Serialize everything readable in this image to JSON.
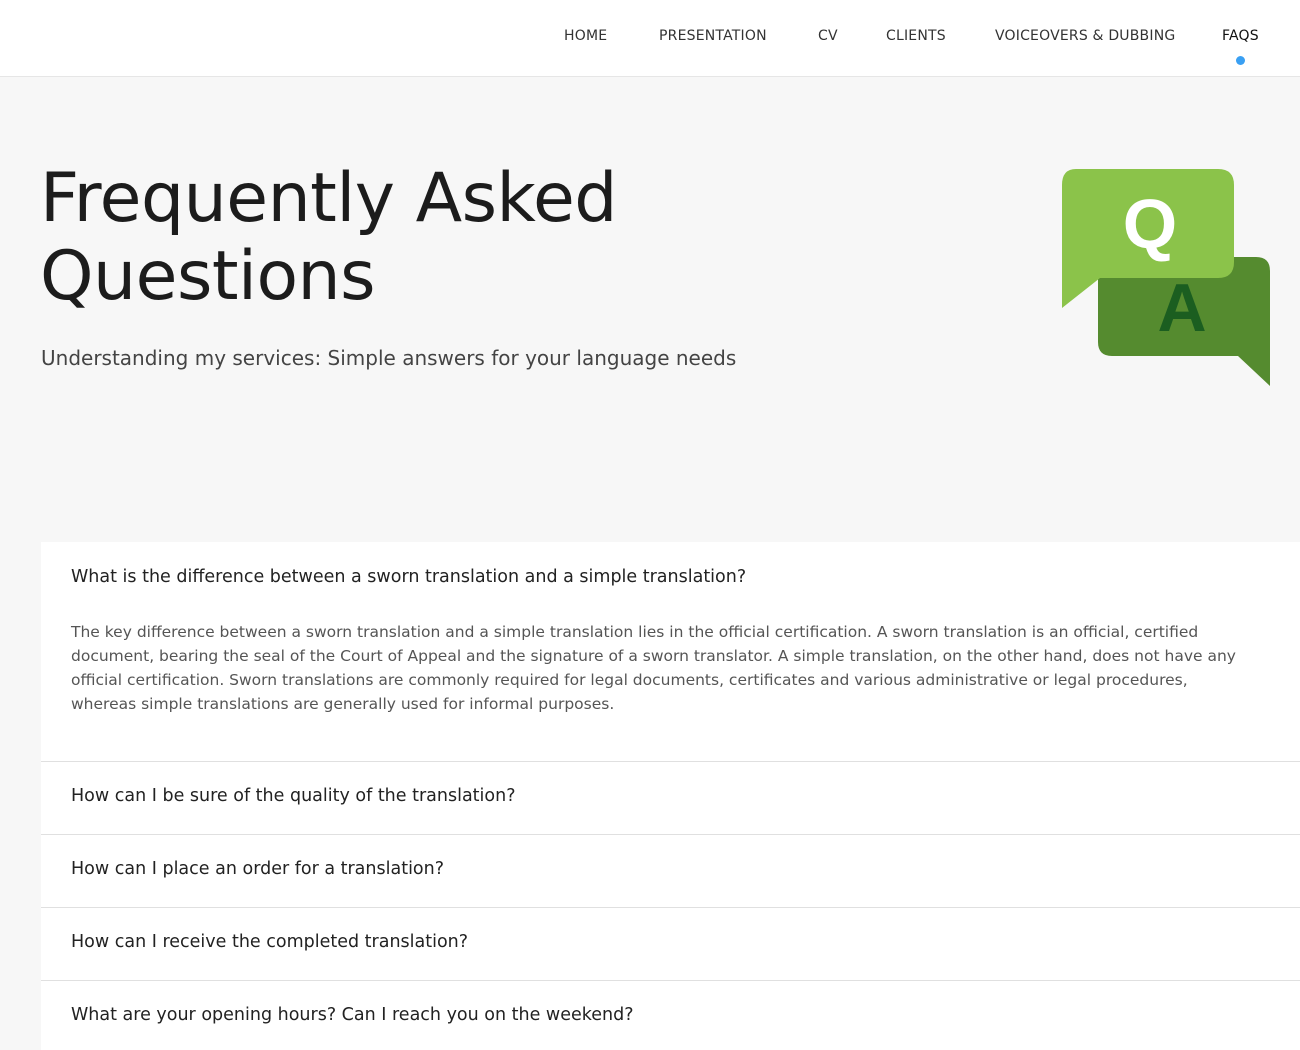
{
  "nav": {
    "items": [
      {
        "label": "HOME"
      },
      {
        "label": "PRESENTATION"
      },
      {
        "label": "CV"
      },
      {
        "label": "CLIENTS"
      },
      {
        "label": "VOICEOVERS & DUBBING"
      },
      {
        "label": "FAQS"
      }
    ],
    "active": "FAQS",
    "active_indicator_color": "#3aa0f3"
  },
  "hero": {
    "title_line1": "Frequently Asked",
    "title_line2": "Questions",
    "subtitle": "Understanding my services: Simple answers for your language needs",
    "illustration": {
      "q_letter": "Q",
      "a_letter": "A",
      "q_color": "#8bc34a",
      "a_color": "#558b2f",
      "a_text_color": "#1b5e20"
    }
  },
  "faqs": [
    {
      "question": "What is the difference between a sworn translation and a simple translation?",
      "answer": "The key difference between a sworn translation and a simple translation lies in the official certification. A sworn translation is an official, certified document, bearing the seal of the Court of Appeal and the signature of a sworn translator. A simple translation, on the other hand, does not have any official certification. Sworn translations are commonly required for legal documents, certificates and various administrative or legal procedures, whereas simple translations are generally used for informal purposes.",
      "expanded": true
    },
    {
      "question": "How can I be sure of the quality of the translation?",
      "expanded": false
    },
    {
      "question": "How can I place an order for a translation?",
      "expanded": false
    },
    {
      "question": "How can I receive the completed translation?",
      "expanded": false
    },
    {
      "question": "What are your opening hours? Can I reach you on the weekend?",
      "expanded": false
    }
  ]
}
